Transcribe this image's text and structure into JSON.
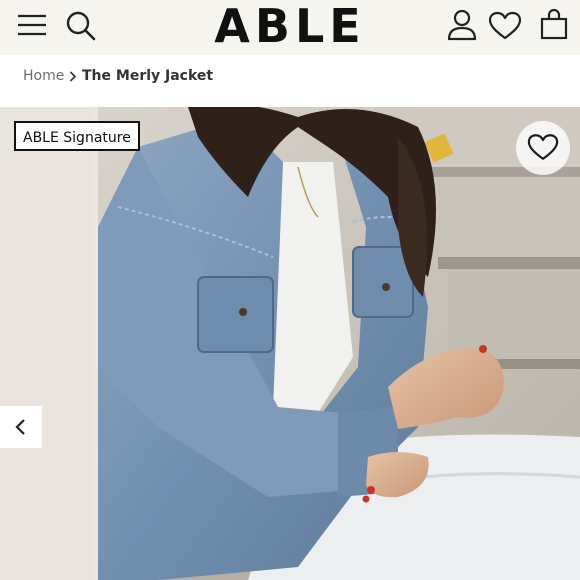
{
  "header": {
    "logo": "ABLE",
    "icons": [
      "menu-icon",
      "search-icon",
      "account-icon",
      "wishlist-icon",
      "bag-icon"
    ]
  },
  "breadcrumb": {
    "home": "Home",
    "current": "The Merly Jacket"
  },
  "product": {
    "badge": "ABLE Signature",
    "image_alt": "Woman wearing a light-wash denim jacket over a white tee and white jeans, seated on stone steps"
  },
  "colors": {
    "background": "#f7f5f0",
    "text": "#111111",
    "denim": "#7a97b6"
  }
}
